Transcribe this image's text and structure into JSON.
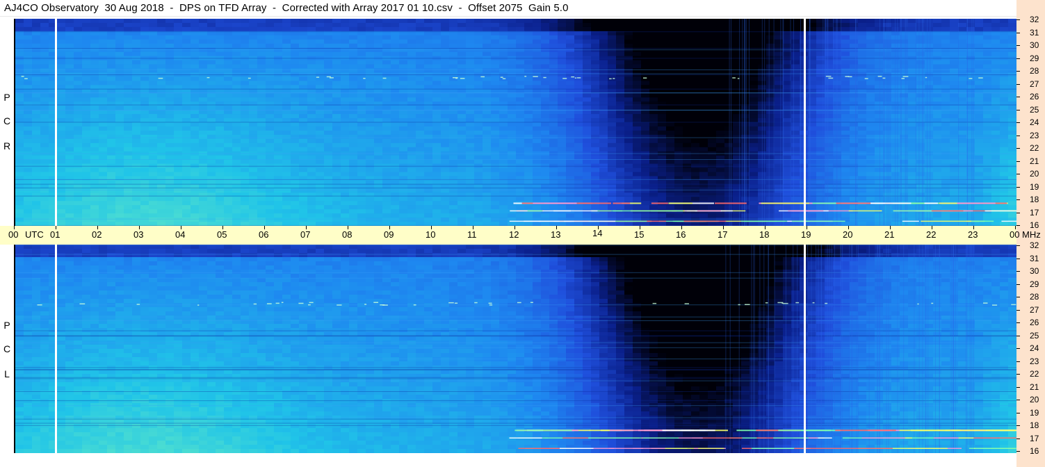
{
  "title": "AJ4CO Observatory  30 Aug 2018  -  DPS on TFD Array  -  Corrected with Array 2017 01 10.csv  -  Offset 2075  Gain 5.0",
  "chart_data": {
    "type": "heatmap",
    "panels": [
      {
        "name": "R C P",
        "letters": [
          "R",
          "C",
          "P"
        ]
      },
      {
        "name": "L C P",
        "letters": [
          "L",
          "C",
          "P"
        ]
      }
    ],
    "x_axis": {
      "ticks": [
        "00",
        "01",
        "02",
        "03",
        "04",
        "05",
        "06",
        "07",
        "08",
        "09",
        "10",
        "11",
        "12",
        "13",
        "14",
        "15",
        "16",
        "17",
        "18",
        "19",
        "20",
        "21",
        "22",
        "23",
        "00"
      ],
      "unit_left": "UTC",
      "unit_right": "MHz",
      "range": [
        0,
        24
      ]
    },
    "y_axis": {
      "ticks": [
        "32",
        "31",
        "30",
        "29",
        "28",
        "27",
        "26",
        "25",
        "24",
        "23",
        "22",
        "21",
        "20",
        "19",
        "18",
        "17",
        "16"
      ],
      "range": [
        16,
        32
      ]
    },
    "markers_utc": [
      1.0,
      18.95
    ],
    "interference_bands_mhz": [
      17.8,
      17.2,
      16.4
    ],
    "colormap": [
      "#000008",
      "#0a1f8a",
      "#1f4fdc",
      "#1e88f0",
      "#20c4e8",
      "#5ee8c8"
    ]
  }
}
